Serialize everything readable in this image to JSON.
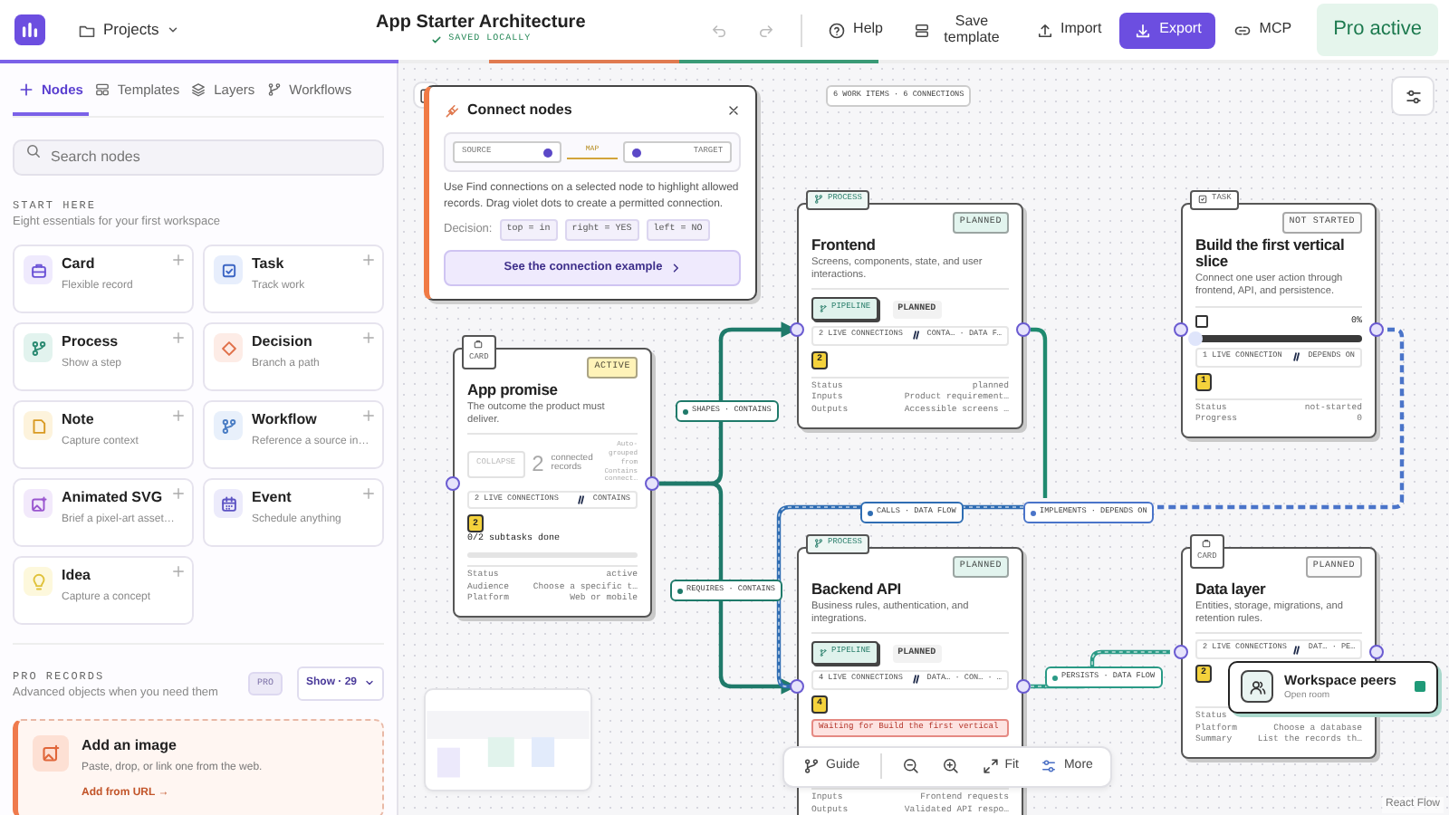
{
  "topbar": {
    "projects": "Projects",
    "title": "App Starter Architecture",
    "save_state": "SAVED LOCALLY",
    "history": [
      {
        "kind": "undo",
        "disabled": true
      },
      {
        "kind": "redo",
        "disabled": true
      }
    ],
    "actions": [
      {
        "kind": "help",
        "label": "Help",
        "primary": false
      },
      {
        "kind": "save",
        "label": "Save template",
        "primary": false
      },
      {
        "kind": "import",
        "label": "Import",
        "primary": false
      },
      {
        "kind": "export",
        "label": "Export",
        "primary": true
      },
      {
        "kind": "mcp",
        "label": "MCP",
        "primary": false
      }
    ],
    "plan": "Pro active"
  },
  "sidebar": {
    "tabs": [
      {
        "kind": "nodes",
        "label": "Nodes",
        "selected": true
      },
      {
        "kind": "templates",
        "label": "Templates",
        "selected": false
      },
      {
        "kind": "layers",
        "label": "Layers",
        "selected": false
      },
      {
        "kind": "workflows",
        "label": "Workflows",
        "selected": false
      }
    ],
    "search": {
      "placeholder": "Search nodes"
    },
    "start_here": {
      "title": "START HERE",
      "subtitle": "Eight essentials for your first workspace",
      "items": [
        {
          "kind": "card",
          "name": "Card",
          "desc": "Flexible record"
        },
        {
          "kind": "task",
          "name": "Task",
          "desc": "Track work"
        },
        {
          "kind": "process",
          "name": "Process",
          "desc": "Show a step"
        },
        {
          "kind": "decision",
          "name": "Decision",
          "desc": "Branch a path"
        },
        {
          "kind": "note",
          "name": "Note",
          "desc": "Capture context"
        },
        {
          "kind": "workflow",
          "name": "Workflow",
          "desc": "Reference a source in…"
        },
        {
          "kind": "animated",
          "name": "Animated SVG",
          "desc": "Brief a pixel-art asset…"
        },
        {
          "kind": "event",
          "name": "Event",
          "desc": "Schedule anything"
        },
        {
          "kind": "idea",
          "name": "Idea",
          "desc": "Capture a concept"
        }
      ]
    },
    "pro_records": {
      "title": "PRO RECORDS",
      "subtitle": "Advanced objects when you need them",
      "badge": "PRO",
      "show": "Show · 29"
    },
    "image_card": {
      "title": "Add an image",
      "desc": "Paste, drop, or link one from the web.",
      "link": "Add from URL →"
    }
  },
  "canvas": {
    "summary": "6 WORK ITEMS · 6 CONNECTIONS",
    "guide": {
      "title": "Connect nodes",
      "source": "SOURCE",
      "map": "MAP",
      "target": "TARGET",
      "text": "Use Find connections on a selected node to highlight allowed records. Drag violet dots to create a permitted connection.",
      "decision_label": "Decision:",
      "chips": [
        "top = in",
        "right = YES",
        "left = NO"
      ],
      "button": "See the connection example"
    },
    "nodes": [
      {
        "kind": "card",
        "type": "CARD",
        "status": {
          "label": "ACTIVE",
          "color": "#fff3b8"
        },
        "title": "App promise",
        "desc": "The outcome the product must deliver.",
        "collapse": {
          "label": "COLLAPSE",
          "count": "2",
          "text": "connected records",
          "note": "Auto-grouped from Contains connect…"
        },
        "live": {
          "label": "2 LIVE CONNECTIONS",
          "tags": "CONTAINS"
        },
        "badge": "2",
        "subtasks": {
          "label": "0/2 subtasks done",
          "level": 0
        },
        "rows": [
          {
            "key": "Status",
            "value": "active"
          },
          {
            "key": "Audience",
            "value": "Choose a specific t…"
          },
          {
            "key": "Platform",
            "value": "Web or mobile"
          }
        ]
      },
      {
        "kind": "process",
        "type": "PROCESS",
        "status": {
          "label": "PLANNED",
          "color": "#e2f4ee"
        },
        "title": "Frontend",
        "desc": "Screens, components, state, and user interactions.",
        "pipeline": {
          "label": "PIPELINE",
          "status": "PLANNED"
        },
        "live": {
          "label": "2 LIVE CONNECTIONS",
          "tags": "CONTA… · DATA F…"
        },
        "badge": "2",
        "rows": [
          {
            "key": "Status",
            "value": "planned"
          },
          {
            "key": "Inputs",
            "value": "Product requirement…"
          },
          {
            "key": "Outputs",
            "value": "Accessible screens …"
          }
        ]
      },
      {
        "kind": "task",
        "type": "TASK",
        "status": {
          "label": "NOT STARTED",
          "color": "#fafafa"
        },
        "title": "Build the first vertical slice",
        "desc": "Connect one user action through frontend, API, and persistence.",
        "progress": {
          "checked": false,
          "label": "0%",
          "level": 0
        },
        "live": {
          "label": "1 LIVE CONNECTION",
          "tags": "DEPENDS ON"
        },
        "badge": "1",
        "rows": [
          {
            "key": "Status",
            "value": "not-started"
          },
          {
            "key": "Progress",
            "value": "0"
          }
        ]
      },
      {
        "kind": "process",
        "type": "PROCESS",
        "status": {
          "label": "PLANNED",
          "color": "#e2f4ee"
        },
        "title": "Backend API",
        "desc": "Business rules, authentication, and integrations.",
        "pipeline": {
          "label": "PIPELINE",
          "status": "PLANNED"
        },
        "live": {
          "label": "4 LIVE CONNECTIONS",
          "tags": "DATA… · CON… · …"
        },
        "badge": "4",
        "warning": "Waiting for Build the first vertical",
        "rows": [
          {
            "key": "Inputs",
            "value": "Frontend requests"
          },
          {
            "key": "Outputs",
            "value": "Validated API respo…"
          }
        ]
      },
      {
        "kind": "card",
        "type": "CARD",
        "status": {
          "label": "PLANNED",
          "color": "#fafafa"
        },
        "title": "Data layer",
        "desc": "Entities, storage, migrations, and retention rules.",
        "live": {
          "label": "2 LIVE CONNECTIONS",
          "tags": "DAT… · PE…"
        },
        "badge": "2",
        "rows": [
          {
            "key": "Status"
          },
          {
            "key": "Platform",
            "value": "Choose a database"
          },
          {
            "key": "Summary",
            "value": "List the records th…"
          }
        ]
      }
    ],
    "edges": [
      {
        "label": "SHAPES · CONTAINS",
        "color": "#1f7a6a",
        "kind": "solid"
      },
      {
        "label": "REQUIRES · CONTAINS",
        "color": "#1f7a6a",
        "kind": "solid"
      },
      {
        "label": "CALLS · DATA FLOW",
        "color": "#2f6db3",
        "kind": "striped"
      },
      {
        "label": "IMPLEMENTS · DEPENDS ON",
        "color": "#4a74c9",
        "kind": "dashed"
      },
      {
        "label": "PERSISTS · DATA FLOW",
        "color": "#2a9a86",
        "kind": "striped"
      },
      {
        "color": "#1f8a6f",
        "kind": "solid"
      }
    ],
    "peers": {
      "title": "Workspace peers",
      "subtitle": "Open room",
      "online": true
    },
    "toolbar": [
      {
        "kind": "guide",
        "label": "Guide"
      },
      {
        "kind": "zoom-out"
      },
      {
        "kind": "zoom-in"
      },
      {
        "kind": "fit",
        "label": "Fit"
      },
      {
        "kind": "more",
        "label": "More"
      }
    ],
    "attribution": "React Flow"
  }
}
